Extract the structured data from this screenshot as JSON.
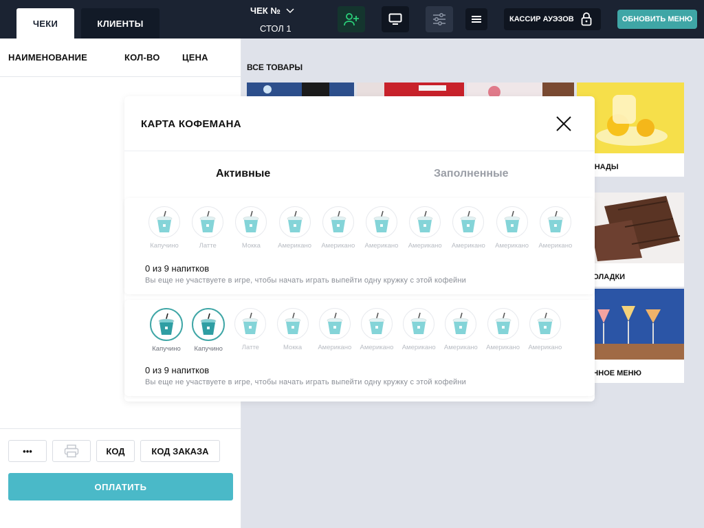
{
  "topbar": {
    "tab_cheki": "ЧЕКИ",
    "tab_clients": "КЛИЕНТЫ",
    "check_title": "ЧЕК №",
    "table_label": "СТОЛ 1",
    "cashier": "КАССИР АУЭЗОВ",
    "refresh_label": "ОБНОВИТЬ МЕНЮ"
  },
  "order": {
    "col_name": "НАИМЕНОВАНИЕ",
    "col_qty": "КОЛ-ВО",
    "col_price": "ЦЕНА",
    "btn_more": "•••",
    "btn_code": "КОД",
    "btn_order_code": "КОД ЗАКАЗА",
    "btn_pay": "ОПЛАТИТЬ"
  },
  "products": {
    "section_title": "ВСЕ ТОВАРЫ",
    "cards": [
      {
        "label": "МОНАДЫ"
      },
      {
        "label": "ОКОЛАДКИ"
      },
      {
        "label": "ЗОННОЕ МЕНЮ"
      }
    ]
  },
  "modal": {
    "title": "КАРТА КОФЕМАНА",
    "tab_active": "Активные",
    "tab_filled": "Заполненные",
    "cards": [
      {
        "cups": [
          {
            "name": "Капучино",
            "filled": false
          },
          {
            "name": "Латте",
            "filled": false
          },
          {
            "name": "Мокка",
            "filled": false
          },
          {
            "name": "Американо",
            "filled": false
          },
          {
            "name": "Американо",
            "filled": false
          },
          {
            "name": "Американо",
            "filled": false
          },
          {
            "name": "Американо",
            "filled": false
          },
          {
            "name": "Американо",
            "filled": false
          },
          {
            "name": "Американо",
            "filled": false
          },
          {
            "name": "Американо",
            "filled": false
          }
        ],
        "count": "0 из 9 напитков",
        "hint": "Вы еще не участвуете в игре, чтобы начать играть выпейти одну кружку с этой кофейни"
      },
      {
        "cups": [
          {
            "name": "Капучино",
            "filled": true
          },
          {
            "name": "Капучино",
            "filled": true
          },
          {
            "name": "Латте",
            "filled": false
          },
          {
            "name": "Мокка",
            "filled": false
          },
          {
            "name": "Американо",
            "filled": false
          },
          {
            "name": "Американо",
            "filled": false
          },
          {
            "name": "Американо",
            "filled": false
          },
          {
            "name": "Американо",
            "filled": false
          },
          {
            "name": "Американо",
            "filled": false
          },
          {
            "name": "Американо",
            "filled": false
          }
        ],
        "count": "0 из 9 напитков",
        "hint": "Вы еще не участвуете в игре, чтобы начать играть выпейти одну кружку с этой кофейни"
      }
    ]
  },
  "colors": {
    "topbar": "#1b2332",
    "accent": "#3fa6a6",
    "pay": "#4ab9c8"
  }
}
